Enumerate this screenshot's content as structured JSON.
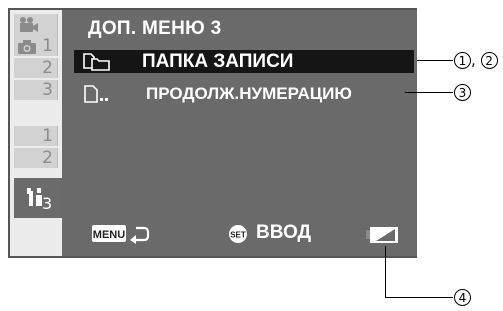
{
  "menu": {
    "title": "ДОП. МЕНЮ 3",
    "items": [
      {
        "label": "ПАПКА ЗАПИСИ",
        "icon": "folder-icon",
        "selected": true
      },
      {
        "label": "ПРОДОЛЖ.НУМЕРАЦИЮ",
        "icon": "file-numbering-icon",
        "selected": false
      }
    ]
  },
  "sidebar": {
    "groups": [
      {
        "icon": "video-camera-icon",
        "numbers": [
          ""
        ]
      },
      {
        "icon": "camera-icon",
        "numbers": [
          "1",
          "2",
          "3"
        ]
      },
      {
        "icon": "",
        "numbers": [
          "1",
          "2"
        ]
      },
      {
        "icon": "tools-icon",
        "numbers": [
          "3"
        ],
        "active": true
      }
    ]
  },
  "footer": {
    "menu_label": "MENU",
    "set_label": "SET",
    "enter_label": "ВВОД",
    "back_icon": "return-arrow-icon",
    "card_icon": "memory-card-icon"
  },
  "callouts": {
    "c1": "1",
    "c2": "2",
    "c3": "3",
    "c4": "4",
    "sep": ", "
  },
  "colors": {
    "panel": "#6a6a6a",
    "highlight": "#151515",
    "sidebar": "#ececec"
  }
}
